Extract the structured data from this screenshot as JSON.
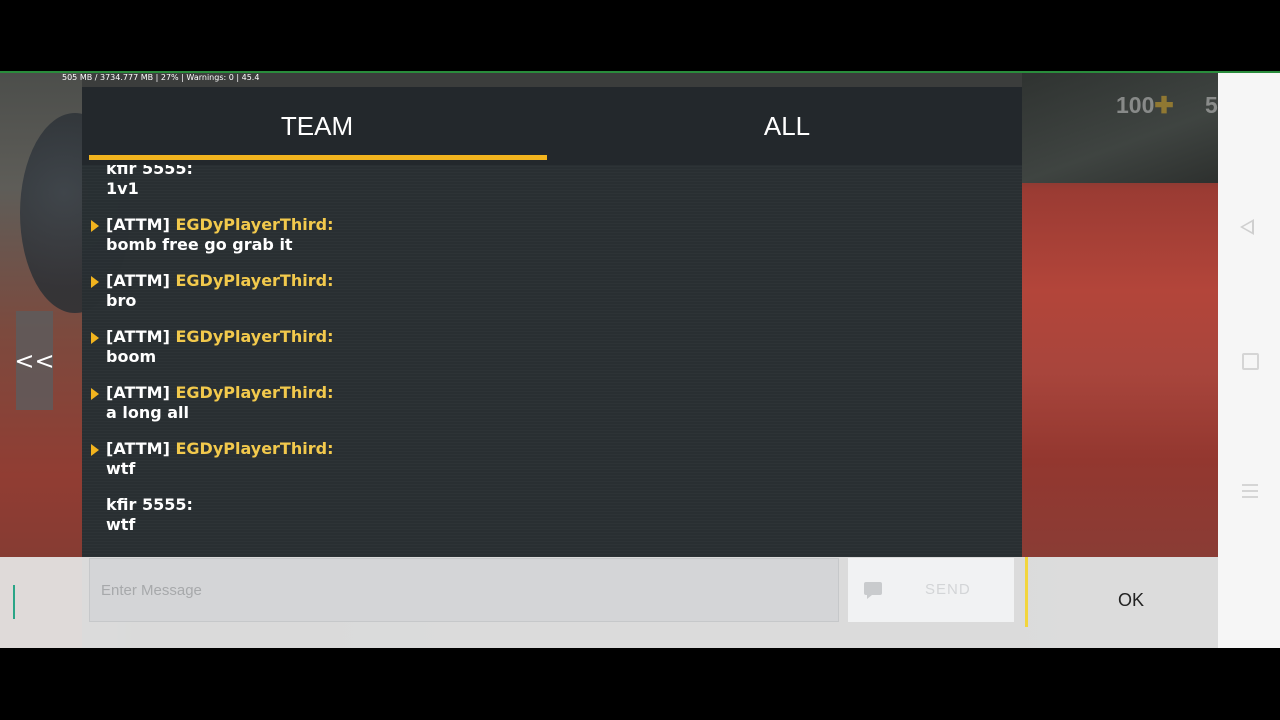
{
  "status_bar": {
    "stats": "505 MB / 3734.777 MB | 27% | Warnings: 0 | 45.4"
  },
  "hud": {
    "health": "100",
    "health_icon": "plus-icon",
    "armor_partial": "5"
  },
  "chat": {
    "tabs": [
      {
        "label": "TEAM",
        "active": true
      },
      {
        "label": "ALL",
        "active": false
      }
    ],
    "accent_color": "#f2b41e",
    "name_color": "#f2c94c",
    "messages": [
      {
        "tag": "",
        "name": "kfir 5555:",
        "text": "1v1",
        "team": false
      },
      {
        "tag": "[ATTM]",
        "name": "EGDyPlayerThird:",
        "text": "bomb free go grab it",
        "team": true
      },
      {
        "tag": "[ATTM]",
        "name": "EGDyPlayerThird:",
        "text": "bro",
        "team": true
      },
      {
        "tag": "[ATTM]",
        "name": "EGDyPlayerThird:",
        "text": "boom",
        "team": true
      },
      {
        "tag": "[ATTM]",
        "name": "EGDyPlayerThird:",
        "text": "a long all",
        "team": true
      },
      {
        "tag": "[ATTM]",
        "name": "EGDyPlayerThird:",
        "text": "wtf",
        "team": true
      },
      {
        "tag": "",
        "name": "kfir 5555:",
        "text": "wtf",
        "team": false
      }
    ],
    "collapse_label": "<<"
  },
  "input": {
    "placeholder": "Enter Message",
    "value": "",
    "send_label": "SEND",
    "send_icon": "chat-bubble-icon",
    "ok_label": "OK"
  },
  "nav": {
    "back_icon": "back-triangle-icon",
    "home_icon": "home-square-icon",
    "menu_icon": "menu-lines-icon"
  }
}
